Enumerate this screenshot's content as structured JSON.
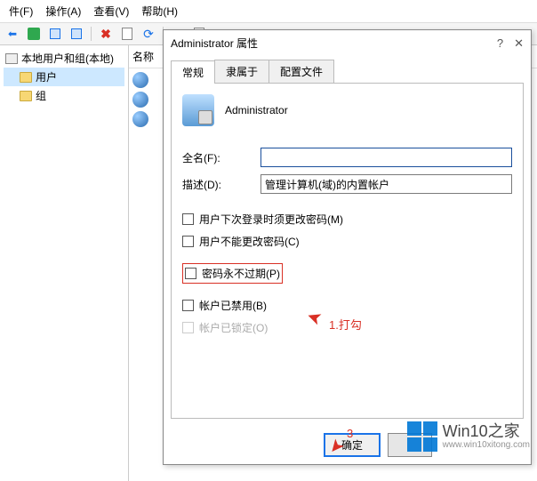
{
  "menu": {
    "file": "件(F)",
    "action": "操作(A)",
    "view": "查看(V)",
    "help": "帮助(H)"
  },
  "tree": {
    "root": "本地用户和组(本地)",
    "users": "用户",
    "groups": "组"
  },
  "list": {
    "header": "名称"
  },
  "dialog": {
    "title": "Administrator 属性",
    "tabs": {
      "general": "常规",
      "memberof": "隶属于",
      "profile": "配置文件"
    },
    "username": "Administrator",
    "fullname_label": "全名(F):",
    "fullname_value": "",
    "desc_label": "描述(D):",
    "desc_value": "管理计算机(域)的内置帐户",
    "checks": {
      "mustchange": "用户下次登录时须更改密码(M)",
      "cannotchange": "用户不能更改密码(C)",
      "neverexpire": "密码永不过期(P)",
      "disabled": "帐户已禁用(B)",
      "locked": "帐户已锁定(O)"
    },
    "buttons": {
      "ok": "确定"
    }
  },
  "annotations": {
    "step1": "1.打勾",
    "step3": "3"
  },
  "watermark": {
    "main": "Win10之家",
    "sub": "www.win10xitong.com"
  }
}
